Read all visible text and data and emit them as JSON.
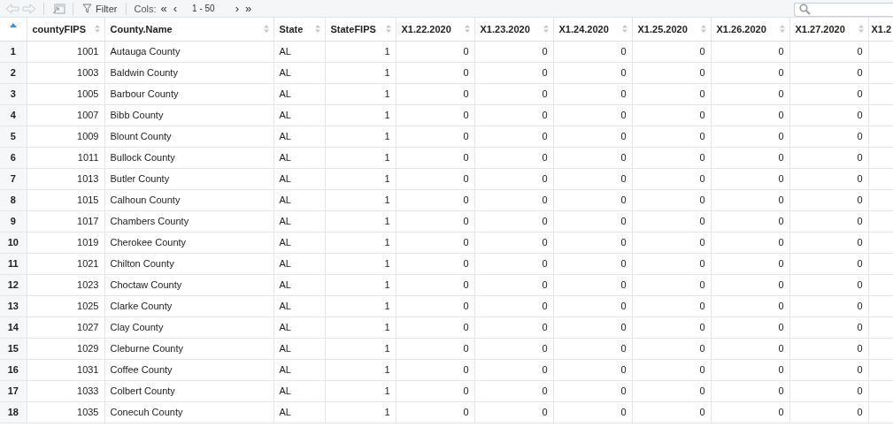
{
  "toolbar": {
    "filter": "Filter",
    "cols_label": "Cols:",
    "first": "«",
    "prev": "‹",
    "range": "1 - 50",
    "next": "›",
    "last": "»"
  },
  "table": {
    "columns": [
      {
        "sorted": true
      },
      {
        "label": "countyFIPS",
        "sorted": false
      },
      {
        "label": "County.Name",
        "sorted": false
      },
      {
        "label": "State",
        "sorted": false
      },
      {
        "label": "StateFIPS",
        "sorted": false
      },
      {
        "label": "X1.22.2020",
        "sorted": false
      },
      {
        "label": "X1.23.2020",
        "sorted": false
      },
      {
        "label": "X1.24.2020",
        "sorted": false
      },
      {
        "label": "X1.25.2020",
        "sorted": false
      },
      {
        "label": "X1.26.2020",
        "sorted": false
      },
      {
        "label": "X1.27.2020",
        "sorted": false
      },
      {
        "label": "X1.2"
      }
    ],
    "rows": [
      [
        "1",
        "1001",
        "Autauga County",
        "AL",
        "1",
        "0",
        "0",
        "0",
        "0",
        "0",
        "0"
      ],
      [
        "2",
        "1003",
        "Baldwin County",
        "AL",
        "1",
        "0",
        "0",
        "0",
        "0",
        "0",
        "0"
      ],
      [
        "3",
        "1005",
        "Barbour County",
        "AL",
        "1",
        "0",
        "0",
        "0",
        "0",
        "0",
        "0"
      ],
      [
        "4",
        "1007",
        "Bibb County",
        "AL",
        "1",
        "0",
        "0",
        "0",
        "0",
        "0",
        "0"
      ],
      [
        "5",
        "1009",
        "Blount County",
        "AL",
        "1",
        "0",
        "0",
        "0",
        "0",
        "0",
        "0"
      ],
      [
        "6",
        "1011",
        "Bullock County",
        "AL",
        "1",
        "0",
        "0",
        "0",
        "0",
        "0",
        "0"
      ],
      [
        "7",
        "1013",
        "Butler County",
        "AL",
        "1",
        "0",
        "0",
        "0",
        "0",
        "0",
        "0"
      ],
      [
        "8",
        "1015",
        "Calhoun County",
        "AL",
        "1",
        "0",
        "0",
        "0",
        "0",
        "0",
        "0"
      ],
      [
        "9",
        "1017",
        "Chambers County",
        "AL",
        "1",
        "0",
        "0",
        "0",
        "0",
        "0",
        "0"
      ],
      [
        "10",
        "1019",
        "Cherokee County",
        "AL",
        "1",
        "0",
        "0",
        "0",
        "0",
        "0",
        "0"
      ],
      [
        "11",
        "1021",
        "Chilton County",
        "AL",
        "1",
        "0",
        "0",
        "0",
        "0",
        "0",
        "0"
      ],
      [
        "12",
        "1023",
        "Choctaw County",
        "AL",
        "1",
        "0",
        "0",
        "0",
        "0",
        "0",
        "0"
      ],
      [
        "13",
        "1025",
        "Clarke County",
        "AL",
        "1",
        "0",
        "0",
        "0",
        "0",
        "0",
        "0"
      ],
      [
        "14",
        "1027",
        "Clay County",
        "AL",
        "1",
        "0",
        "0",
        "0",
        "0",
        "0",
        "0"
      ],
      [
        "15",
        "1029",
        "Cleburne County",
        "AL",
        "1",
        "0",
        "0",
        "0",
        "0",
        "0",
        "0"
      ],
      [
        "16",
        "1031",
        "Coffee County",
        "AL",
        "1",
        "0",
        "0",
        "0",
        "0",
        "0",
        "0"
      ],
      [
        "17",
        "1033",
        "Colbert County",
        "AL",
        "1",
        "0",
        "0",
        "0",
        "0",
        "0",
        "0"
      ],
      [
        "18",
        "1035",
        "Conecuh County",
        "AL",
        "1",
        "0",
        "0",
        "0",
        "0",
        "0",
        "0"
      ]
    ]
  }
}
